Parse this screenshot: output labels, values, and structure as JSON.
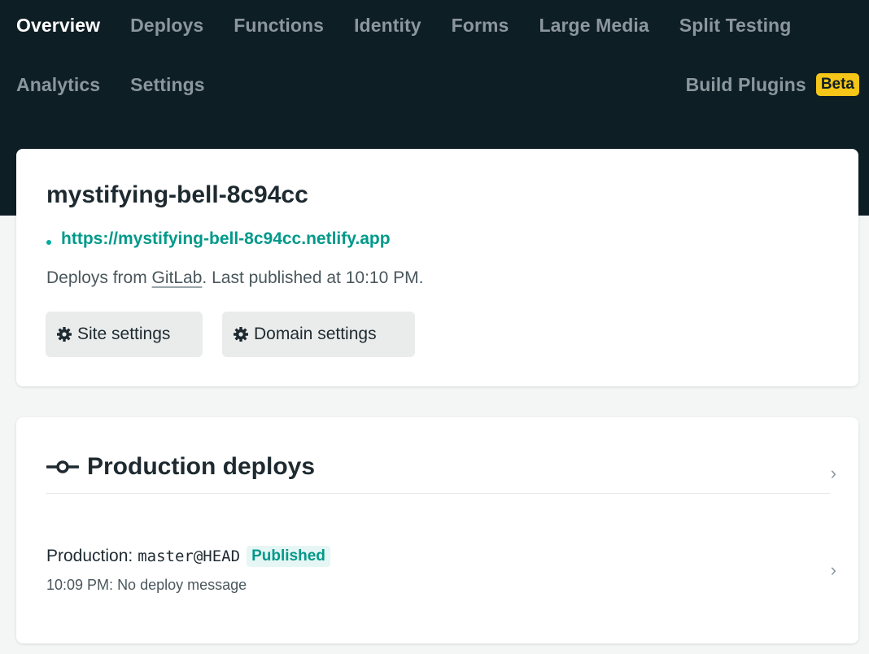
{
  "nav": {
    "row1": [
      "Overview",
      "Deploys",
      "Functions",
      "Identity",
      "Forms",
      "Large Media",
      "Split Testing"
    ],
    "row2": [
      "Analytics",
      "Settings"
    ],
    "build_plugins": "Build Plugins",
    "beta": "Beta",
    "active": "Overview"
  },
  "site": {
    "name": "mystifying-bell-8c94cc",
    "url": "https://mystifying-bell-8c94cc.netlify.app",
    "meta_prefix": "Deploys from ",
    "meta_link": "GitLab",
    "meta_suffix": ". Last published at 10:10 PM.",
    "site_settings_label": "Site settings",
    "domain_settings_label": "Domain settings"
  },
  "deploys": {
    "title": "Production deploys",
    "row": {
      "label": "Production:",
      "branch": "master@HEAD",
      "status": "Published",
      "time": "10:09 PM:",
      "message": "No deploy message"
    }
  },
  "colors": {
    "topbar": "#0e1e25",
    "accent": "#00998a",
    "beta": "#f5c518"
  },
  "icons": [
    "gear-icon",
    "commit-icon",
    "chevron-right-icon"
  ]
}
